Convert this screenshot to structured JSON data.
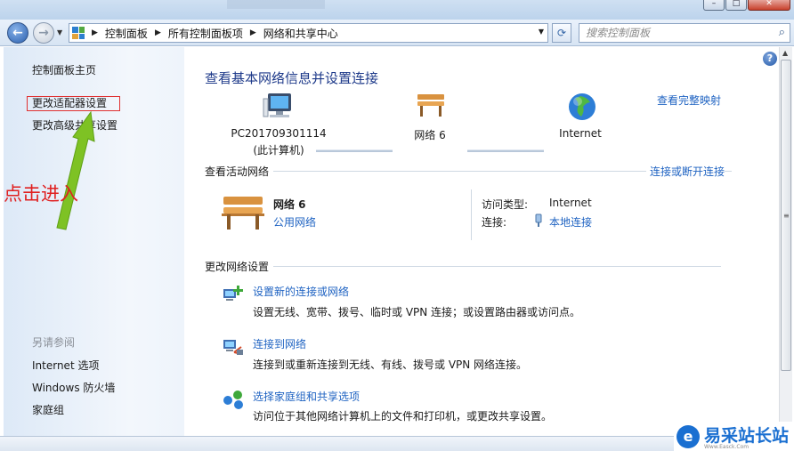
{
  "window": {
    "controls": {
      "minimize": "–",
      "maximize": "□",
      "close": "✕"
    }
  },
  "address_bar": {
    "back_icon": "back-arrow-icon",
    "forward_icon": "forward-arrow-icon",
    "breadcrumbs": [
      "控制面板",
      "所有控制面板项",
      "网络和共享中心"
    ],
    "search_placeholder": "搜索控制面板"
  },
  "sidebar": {
    "home": "控制面板主页",
    "change_adapter": "更改适配器设置",
    "change_sharing": "更改高级共享设置",
    "see_also_heading": "另请参阅",
    "see_also": [
      "Internet 选项",
      "Windows 防火墙",
      "家庭组"
    ]
  },
  "annotation": {
    "text": "点击进入",
    "color": "#e02020"
  },
  "main": {
    "title": "查看基本网络信息并设置连接",
    "view_full_map": "查看完整映射",
    "network_map": {
      "computer_name": "PC201709301114",
      "computer_sub": "(此计算机)",
      "network_name": "网络  6",
      "internet": "Internet"
    },
    "active_networks": {
      "heading": "查看活动网络",
      "connect_link": "连接或断开连接",
      "network_name": "网络  6",
      "network_type": "公用网络",
      "access_type_label": "访问类型:",
      "access_type_value": "Internet",
      "connections_label": "连接:",
      "connections_value": "本地连接"
    },
    "change_settings": {
      "heading": "更改网络设置",
      "tasks": [
        {
          "title": "设置新的连接或网络",
          "desc": "设置无线、宽带、拨号、临时或 VPN 连接；或设置路由器或访问点。"
        },
        {
          "title": "连接到网络",
          "desc": "连接到或重新连接到无线、有线、拨号或 VPN 网络连接。"
        },
        {
          "title": "选择家庭组和共享选项",
          "desc": "访问位于其他网络计算机上的文件和打印机，或更改共享设置。"
        }
      ]
    }
  },
  "watermark": {
    "logo_char": "e",
    "text": "易采站长站",
    "sub": "Www.Easck.Com"
  }
}
